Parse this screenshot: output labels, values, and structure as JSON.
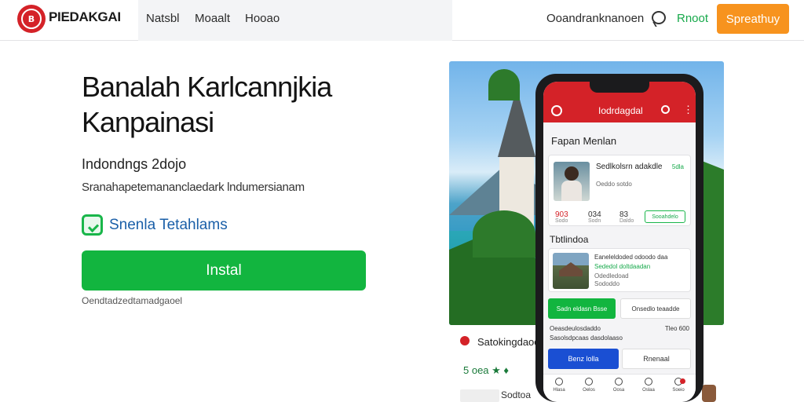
{
  "header": {
    "logo_mark": "B",
    "brand": "PIEDAKGAI",
    "nav": [
      "Natsbl",
      "Moaalt",
      "Hooao"
    ],
    "account": "Ooandranknanoen",
    "register": "Rnoot",
    "cta": "Spreathuy"
  },
  "hero": {
    "title": "Banalah Karlcannjkia Kanpainasi",
    "subtitle": "Indondngs 2dojo",
    "description": "Sranahapetemananclaedark lndumersianam",
    "feature": "Snenla Tetahlams",
    "install": "Instal",
    "note": "Oendtadzedtamadgaoel"
  },
  "phone": {
    "title": "Iodrdagdal",
    "more": "⋮",
    "section1": "Fapan Menlan",
    "profile": {
      "name": "Sedlkolsrn adakdle",
      "badge": "5dla",
      "info": "Oeddo sotdo",
      "stats": [
        "903",
        "034",
        "83"
      ],
      "stat_labels": [
        "Sodo",
        "Sodn",
        "Daldo"
      ],
      "follow": "Sooahdelo"
    },
    "section2": "Tbtlindoa",
    "listing": {
      "l1": "Eaneleldoded odoodo daa",
      "l2": "Sededol doltdaadan",
      "l3": "Odedledoad",
      "l4": "Sododdo"
    },
    "btn_green": "Sadn eldasn Bsse",
    "btn_white": "Onsedlo teaadde",
    "info1": "Oeasdeulosdaddo",
    "info1r": "Tleo 600",
    "info2": "Sasolsdpcaas dasdolaaso",
    "btn_blue": "Benz lolla",
    "btn_white2": "Rnenaal",
    "tabs": [
      "Hlasa",
      "Oelos",
      "Oosa",
      "Oslaa",
      "Soeio"
    ]
  },
  "strip": {
    "title": "Satokingdaoo",
    "meta": "5 oea    ★ ♦",
    "card": "Sodtoa"
  },
  "colors": {
    "brand_red": "#d42228",
    "green": "#12b53f",
    "orange": "#f7931e",
    "blue": "#1a4fd3"
  }
}
